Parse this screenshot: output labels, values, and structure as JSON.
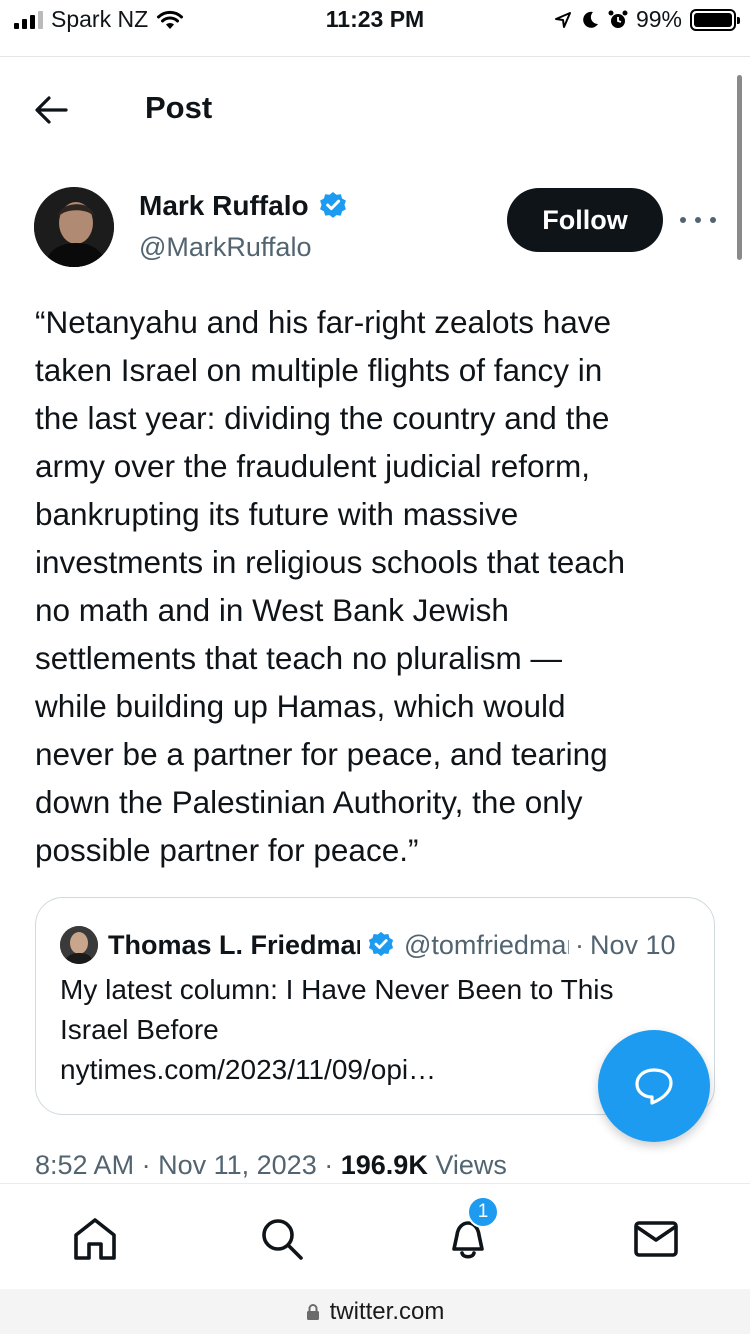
{
  "status_bar": {
    "carrier": "Spark NZ",
    "time": "11:23 PM",
    "battery": "99%",
    "battery_level": 0.99,
    "icons": [
      "signal-icon",
      "wifi-icon",
      "location-icon",
      "moon-icon",
      "alarm-icon",
      "battery-icon"
    ]
  },
  "header": {
    "title": "Post"
  },
  "post": {
    "author_name": "Mark Ruffalo",
    "author_handle": "@MarkRuffalo",
    "follow_label": "Follow",
    "text": "“Netanyahu and his far-right zealots have\ntaken Israel on multiple flights of fancy in\nthe last year: dividing the country and the\narmy over the fraudulent judicial reform,\nbankrupting its future with massive\ninvestments in religious schools that teach\nno math and in West Bank Jewish\nsettlements that teach no pluralism —\nwhile building up Hamas, which would\nnever be a partner for peace, and tearing\ndown the Palestinian Authority, the only\npossible partner for peace.”",
    "time": "8:52 AM",
    "sep": "·",
    "date": "Nov 11, 2023",
    "views_count": "196.9K",
    "views_label": "Views"
  },
  "quote": {
    "name": "Thomas L. Friedman",
    "handle": "@tomfriedman",
    "sep": "·",
    "date": "Nov 10",
    "text": "My latest column: I Have Never Been to This\nIsrael Before",
    "link": "nytimes.com/2023/11/09/opi…"
  },
  "tabbar": {
    "items": [
      "home-icon",
      "search-icon",
      "notifications-icon",
      "messages-icon"
    ],
    "notification_count": "1"
  },
  "browser": {
    "url": "twitter.com"
  },
  "colors": {
    "accent": "#1d9bf0",
    "text": "#0f1419",
    "secondary": "#536471"
  }
}
